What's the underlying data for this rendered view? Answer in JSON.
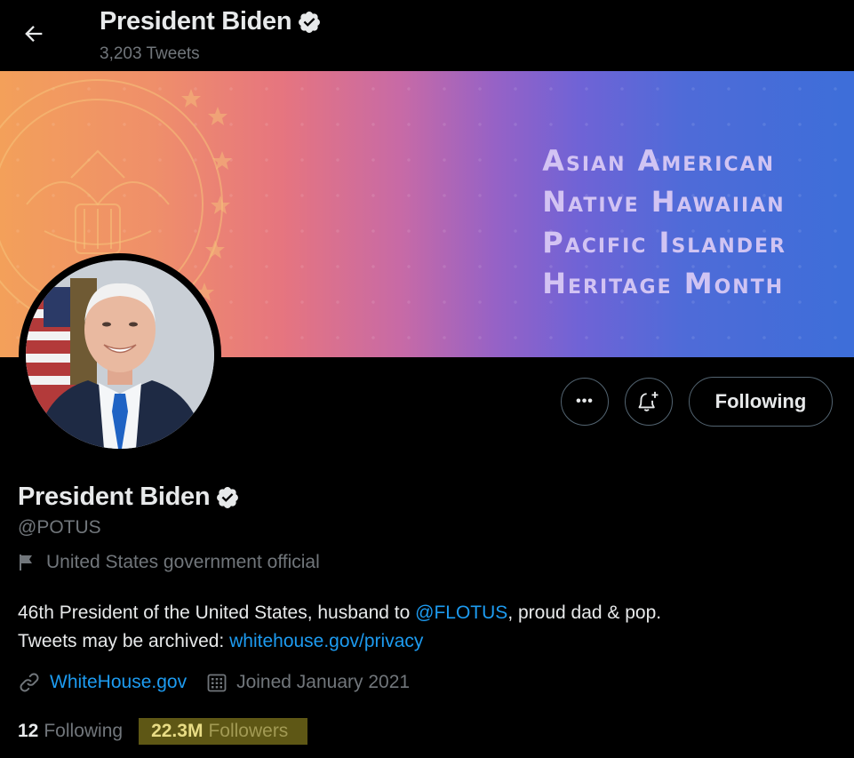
{
  "header": {
    "name": "President Biden",
    "tweet_count": "3,203 Tweets"
  },
  "banner": {
    "lines": [
      "Asian American",
      "Native Hawaiian",
      "Pacific Islander",
      "Heritage Month"
    ]
  },
  "actions": {
    "more_label": "•••",
    "following_label": "Following"
  },
  "profile": {
    "name": "President Biden",
    "handle": "@POTUS",
    "category": "United States government official",
    "bio": {
      "line1_pre": "46th President of the United States, husband to ",
      "line1_link": "@FLOTUS",
      "line1_post": ", proud dad & pop.",
      "line2_pre": "Tweets may be archived: ",
      "line2_link": "whitehouse.gov/privacy"
    },
    "website": "WhiteHouse.gov",
    "joined": "Joined January 2021"
  },
  "stats": {
    "following_count": "12",
    "following_label": "Following",
    "followers_count": "22.3M",
    "followers_label": "Followers"
  },
  "icons": {
    "back": "arrow-left-icon",
    "verified": "verified-badge-icon",
    "more": "more-icon",
    "notify": "bell-plus-icon",
    "category": "flag-icon",
    "website": "link-icon",
    "joined": "calendar-icon"
  },
  "colors": {
    "background": "#000000",
    "text": "#e7e9ea",
    "secondary": "#71767b",
    "link": "#1d9bf0",
    "highlight": "#5e5715"
  }
}
